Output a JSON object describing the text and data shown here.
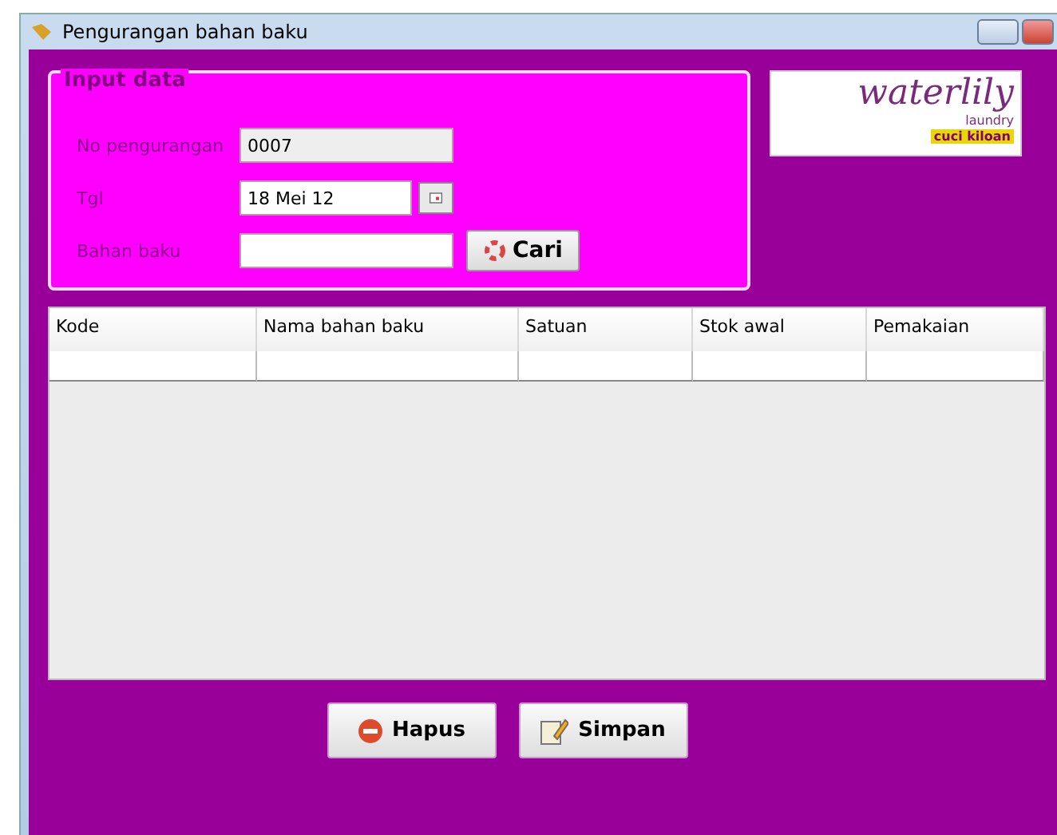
{
  "window": {
    "title": "Pengurangan bahan baku"
  },
  "input_group": {
    "title": "Input data",
    "fields": [
      {
        "label": "No pengurangan",
        "value": "0007",
        "kind": "readonly"
      },
      {
        "label": "Tgl",
        "value": "18 Mei 12",
        "kind": "date"
      },
      {
        "label": "Bahan baku",
        "kind": "search",
        "button": "Cari"
      }
    ]
  },
  "logo": {
    "name": "waterlily",
    "sub": "laundry",
    "tag": "cuci kiloan"
  },
  "table": {
    "columns": [
      "Kode",
      "Nama bahan baku",
      "Satuan",
      "Stok awal",
      "Pemakaian"
    ]
  },
  "buttons": [
    {
      "label": "Hapus",
      "kind": "delete"
    },
    {
      "label": "Simpan",
      "kind": "save"
    }
  ]
}
